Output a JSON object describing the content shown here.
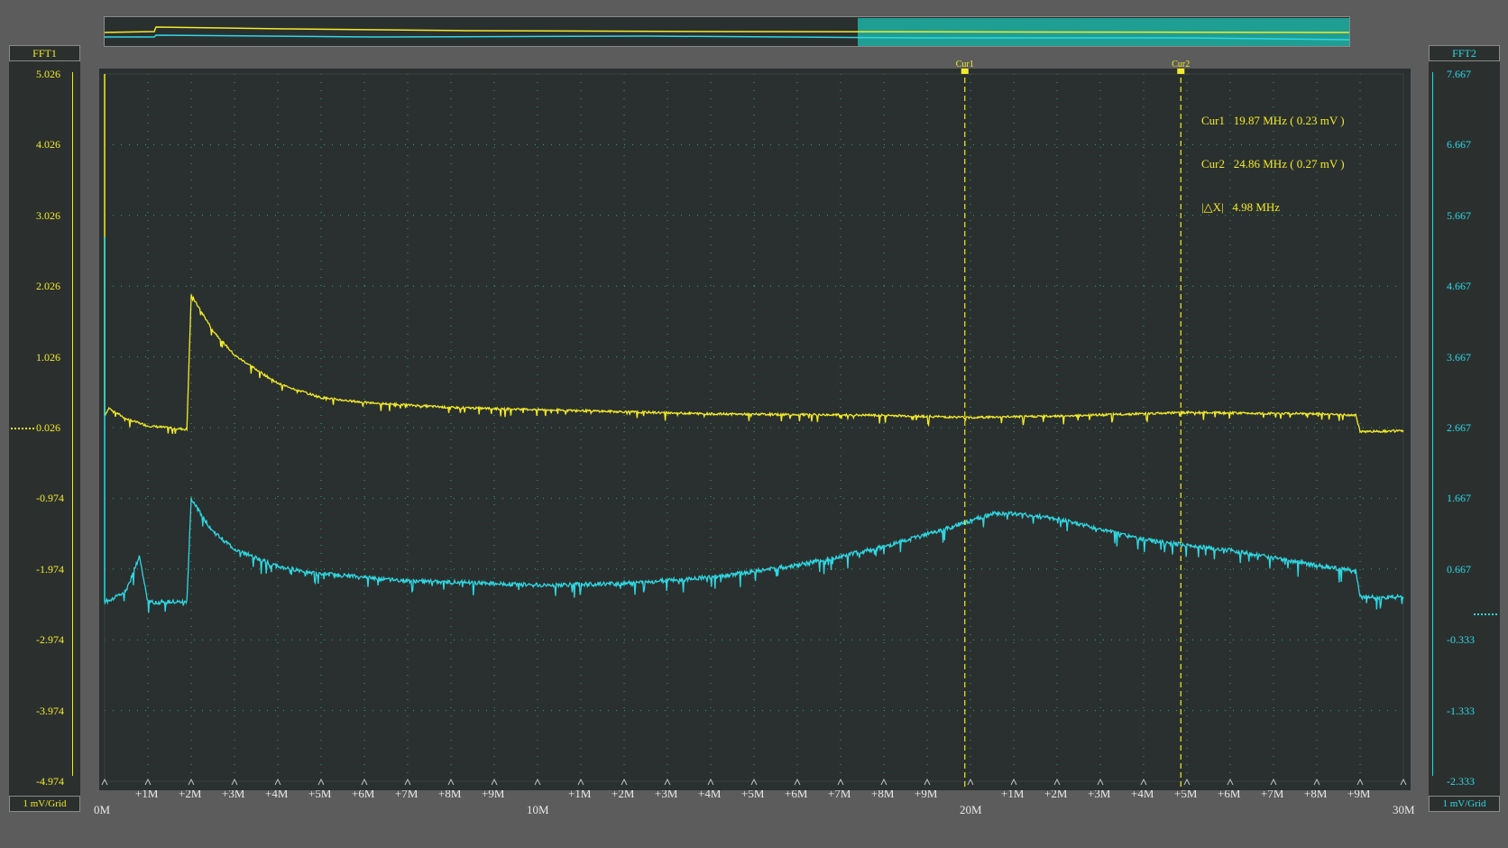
{
  "left_panel": {
    "title": "FFT1",
    "footer": "1 mV/Grid",
    "ticks": [
      "5.026",
      "4.026",
      "3.026",
      "2.026",
      "1.026",
      "0.026",
      "-0.974",
      "-1.974",
      "-2.974",
      "-3.974",
      "-4.974"
    ]
  },
  "right_panel": {
    "title": "FFT2",
    "footer": "1 mV/Grid",
    "ticks": [
      "7.667",
      "6.667",
      "5.667",
      "4.667",
      "3.667",
      "2.667",
      "1.667",
      "0.667",
      "-0.333",
      "-1.333",
      "-2.333"
    ]
  },
  "cursors": {
    "cur1_tag": "Cur1",
    "cur2_tag": "Cur2",
    "line1": "Cur1   19.87 MHz ( 0.23 mV )",
    "line2": "Cur2   24.86 MHz ( 0.27 mV )",
    "line3": "|△X|   4.98 MHz",
    "cur1_freq_mhz": 19.87,
    "cur2_freq_mhz": 24.86
  },
  "x_axis": {
    "major": [
      "0M",
      "10M",
      "20M",
      "30M"
    ],
    "minor": [
      "+1M",
      "+2M",
      "+3M",
      "+4M",
      "+5M",
      "+6M",
      "+7M",
      "+8M",
      "+9M"
    ]
  },
  "colors": {
    "ch1": "#f2ea2a",
    "ch2": "#2fd7e3",
    "grid": "#2fd7a0",
    "panel": "#2a302f"
  },
  "chart_data": {
    "type": "line",
    "x_range_mhz": [
      0,
      30
    ],
    "series": [
      {
        "name": "FFT1",
        "color": "#f2ea2a",
        "ylim": [
          -4.974,
          5.026
        ],
        "x": [
          0,
          0.1,
          0.5,
          1,
          1.9,
          2.0,
          2.5,
          3,
          4,
          5,
          6,
          8,
          10,
          14,
          18,
          20,
          22,
          25,
          28,
          28.9,
          29,
          30
        ],
        "y": [
          0.2,
          0.3,
          0.15,
          0.05,
          0.0,
          1.9,
          1.4,
          1.05,
          0.65,
          0.45,
          0.38,
          0.31,
          0.28,
          0.22,
          0.2,
          0.17,
          0.19,
          0.24,
          0.22,
          0.2,
          -0.03,
          -0.02
        ]
      },
      {
        "name": "FFT2",
        "color": "#2fd7e3",
        "ylim": [
          -2.333,
          7.667
        ],
        "x": [
          0,
          0.5,
          0.8,
          1,
          1.9,
          2.0,
          2.5,
          3,
          4,
          5,
          7,
          10,
          12,
          14,
          16,
          18,
          19.5,
          20.5,
          21,
          22,
          24,
          26,
          28,
          28.9,
          29,
          30
        ],
        "y": [
          0.2,
          0.35,
          0.85,
          0.2,
          0.2,
          1.65,
          1.2,
          0.95,
          0.7,
          0.6,
          0.5,
          0.44,
          0.46,
          0.55,
          0.72,
          0.98,
          1.25,
          1.45,
          1.45,
          1.38,
          1.08,
          0.93,
          0.72,
          0.64,
          0.27,
          0.27
        ]
      }
    ]
  }
}
